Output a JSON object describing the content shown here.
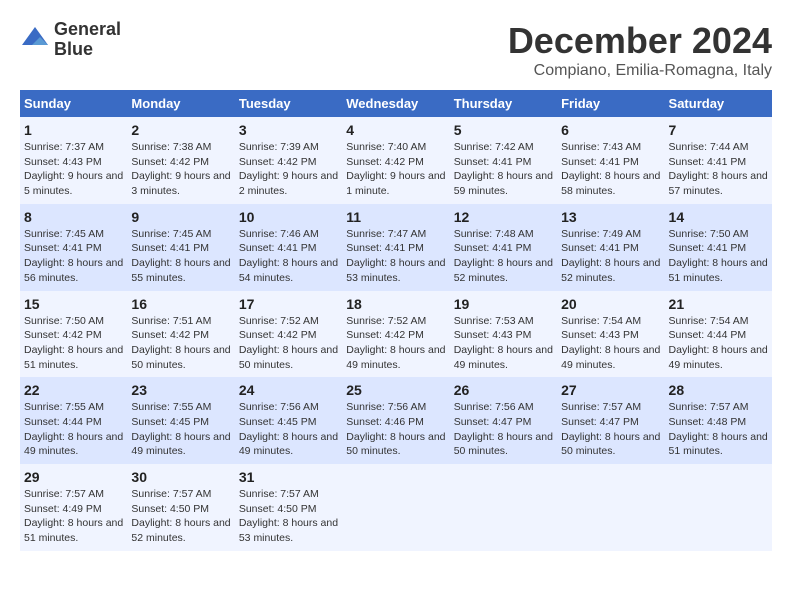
{
  "header": {
    "logo_line1": "General",
    "logo_line2": "Blue",
    "main_title": "December 2024",
    "subtitle": "Compiano, Emilia-Romagna, Italy"
  },
  "weekdays": [
    "Sunday",
    "Monday",
    "Tuesday",
    "Wednesday",
    "Thursday",
    "Friday",
    "Saturday"
  ],
  "weeks": [
    [
      {
        "day": "1",
        "sunrise": "Sunrise: 7:37 AM",
        "sunset": "Sunset: 4:43 PM",
        "daylight": "Daylight: 9 hours and 5 minutes."
      },
      {
        "day": "2",
        "sunrise": "Sunrise: 7:38 AM",
        "sunset": "Sunset: 4:42 PM",
        "daylight": "Daylight: 9 hours and 3 minutes."
      },
      {
        "day": "3",
        "sunrise": "Sunrise: 7:39 AM",
        "sunset": "Sunset: 4:42 PM",
        "daylight": "Daylight: 9 hours and 2 minutes."
      },
      {
        "day": "4",
        "sunrise": "Sunrise: 7:40 AM",
        "sunset": "Sunset: 4:42 PM",
        "daylight": "Daylight: 9 hours and 1 minute."
      },
      {
        "day": "5",
        "sunrise": "Sunrise: 7:42 AM",
        "sunset": "Sunset: 4:41 PM",
        "daylight": "Daylight: 8 hours and 59 minutes."
      },
      {
        "day": "6",
        "sunrise": "Sunrise: 7:43 AM",
        "sunset": "Sunset: 4:41 PM",
        "daylight": "Daylight: 8 hours and 58 minutes."
      },
      {
        "day": "7",
        "sunrise": "Sunrise: 7:44 AM",
        "sunset": "Sunset: 4:41 PM",
        "daylight": "Daylight: 8 hours and 57 minutes."
      }
    ],
    [
      {
        "day": "8",
        "sunrise": "Sunrise: 7:45 AM",
        "sunset": "Sunset: 4:41 PM",
        "daylight": "Daylight: 8 hours and 56 minutes."
      },
      {
        "day": "9",
        "sunrise": "Sunrise: 7:45 AM",
        "sunset": "Sunset: 4:41 PM",
        "daylight": "Daylight: 8 hours and 55 minutes."
      },
      {
        "day": "10",
        "sunrise": "Sunrise: 7:46 AM",
        "sunset": "Sunset: 4:41 PM",
        "daylight": "Daylight: 8 hours and 54 minutes."
      },
      {
        "day": "11",
        "sunrise": "Sunrise: 7:47 AM",
        "sunset": "Sunset: 4:41 PM",
        "daylight": "Daylight: 8 hours and 53 minutes."
      },
      {
        "day": "12",
        "sunrise": "Sunrise: 7:48 AM",
        "sunset": "Sunset: 4:41 PM",
        "daylight": "Daylight: 8 hours and 52 minutes."
      },
      {
        "day": "13",
        "sunrise": "Sunrise: 7:49 AM",
        "sunset": "Sunset: 4:41 PM",
        "daylight": "Daylight: 8 hours and 52 minutes."
      },
      {
        "day": "14",
        "sunrise": "Sunrise: 7:50 AM",
        "sunset": "Sunset: 4:41 PM",
        "daylight": "Daylight: 8 hours and 51 minutes."
      }
    ],
    [
      {
        "day": "15",
        "sunrise": "Sunrise: 7:50 AM",
        "sunset": "Sunset: 4:42 PM",
        "daylight": "Daylight: 8 hours and 51 minutes."
      },
      {
        "day": "16",
        "sunrise": "Sunrise: 7:51 AM",
        "sunset": "Sunset: 4:42 PM",
        "daylight": "Daylight: 8 hours and 50 minutes."
      },
      {
        "day": "17",
        "sunrise": "Sunrise: 7:52 AM",
        "sunset": "Sunset: 4:42 PM",
        "daylight": "Daylight: 8 hours and 50 minutes."
      },
      {
        "day": "18",
        "sunrise": "Sunrise: 7:52 AM",
        "sunset": "Sunset: 4:42 PM",
        "daylight": "Daylight: 8 hours and 49 minutes."
      },
      {
        "day": "19",
        "sunrise": "Sunrise: 7:53 AM",
        "sunset": "Sunset: 4:43 PM",
        "daylight": "Daylight: 8 hours and 49 minutes."
      },
      {
        "day": "20",
        "sunrise": "Sunrise: 7:54 AM",
        "sunset": "Sunset: 4:43 PM",
        "daylight": "Daylight: 8 hours and 49 minutes."
      },
      {
        "day": "21",
        "sunrise": "Sunrise: 7:54 AM",
        "sunset": "Sunset: 4:44 PM",
        "daylight": "Daylight: 8 hours and 49 minutes."
      }
    ],
    [
      {
        "day": "22",
        "sunrise": "Sunrise: 7:55 AM",
        "sunset": "Sunset: 4:44 PM",
        "daylight": "Daylight: 8 hours and 49 minutes."
      },
      {
        "day": "23",
        "sunrise": "Sunrise: 7:55 AM",
        "sunset": "Sunset: 4:45 PM",
        "daylight": "Daylight: 8 hours and 49 minutes."
      },
      {
        "day": "24",
        "sunrise": "Sunrise: 7:56 AM",
        "sunset": "Sunset: 4:45 PM",
        "daylight": "Daylight: 8 hours and 49 minutes."
      },
      {
        "day": "25",
        "sunrise": "Sunrise: 7:56 AM",
        "sunset": "Sunset: 4:46 PM",
        "daylight": "Daylight: 8 hours and 50 minutes."
      },
      {
        "day": "26",
        "sunrise": "Sunrise: 7:56 AM",
        "sunset": "Sunset: 4:47 PM",
        "daylight": "Daylight: 8 hours and 50 minutes."
      },
      {
        "day": "27",
        "sunrise": "Sunrise: 7:57 AM",
        "sunset": "Sunset: 4:47 PM",
        "daylight": "Daylight: 8 hours and 50 minutes."
      },
      {
        "day": "28",
        "sunrise": "Sunrise: 7:57 AM",
        "sunset": "Sunset: 4:48 PM",
        "daylight": "Daylight: 8 hours and 51 minutes."
      }
    ],
    [
      {
        "day": "29",
        "sunrise": "Sunrise: 7:57 AM",
        "sunset": "Sunset: 4:49 PM",
        "daylight": "Daylight: 8 hours and 51 minutes."
      },
      {
        "day": "30",
        "sunrise": "Sunrise: 7:57 AM",
        "sunset": "Sunset: 4:50 PM",
        "daylight": "Daylight: 8 hours and 52 minutes."
      },
      {
        "day": "31",
        "sunrise": "Sunrise: 7:57 AM",
        "sunset": "Sunset: 4:50 PM",
        "daylight": "Daylight: 8 hours and 53 minutes."
      },
      null,
      null,
      null,
      null
    ]
  ]
}
